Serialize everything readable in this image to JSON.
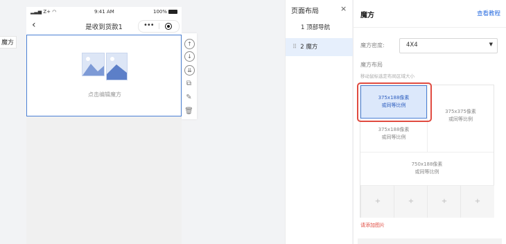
{
  "side_tag": "魔方",
  "phone": {
    "status": {
      "carrier": "Z+",
      "time": "9:41 AM",
      "battery": "100%"
    },
    "nav": {
      "title": "是收到货款1",
      "more": "•••"
    },
    "cube": {
      "placeholder": "点击编辑魔方"
    }
  },
  "toolbar": {
    "icons": [
      "arrow-up-icon",
      "arrow-down-icon",
      "double-arrow-down-icon",
      "copy-icon",
      "edit-icon",
      "delete-icon"
    ],
    "glyphs": {
      "up": "↑",
      "down": "↓",
      "bottom": "⇊",
      "copy": "⧉",
      "edit": "✎",
      "delete": "🗑"
    }
  },
  "layout_panel": {
    "title": "页面布局",
    "close": "×",
    "items": [
      {
        "label": "1 顶部导航"
      },
      {
        "label": "2 魔方"
      }
    ]
  },
  "right_panel": {
    "title": "魔方",
    "tutorial_link": "查看教程",
    "density_label": "魔方密度:",
    "density_value": "4X4",
    "layout_label": "魔方布局",
    "layout_hint": "移动鼠标选定布局区域大小",
    "cells": {
      "a": {
        "line1": "375x188像素",
        "line2": "或同等比例"
      },
      "b": {
        "line1": "375x375像素",
        "line2": "或同等比例"
      },
      "c": {
        "line1": "375x188像素",
        "line2": "或同等比例"
      },
      "d": {
        "line1": "750x188像素",
        "line2": "或同等比例"
      }
    },
    "plus": "+",
    "add_image_hint": "请添加图片"
  },
  "colors": {
    "accent": "#4a7fd4",
    "link": "#2d6fe0",
    "highlight": "#e04a3f",
    "selected_bg": "#e6effc"
  }
}
